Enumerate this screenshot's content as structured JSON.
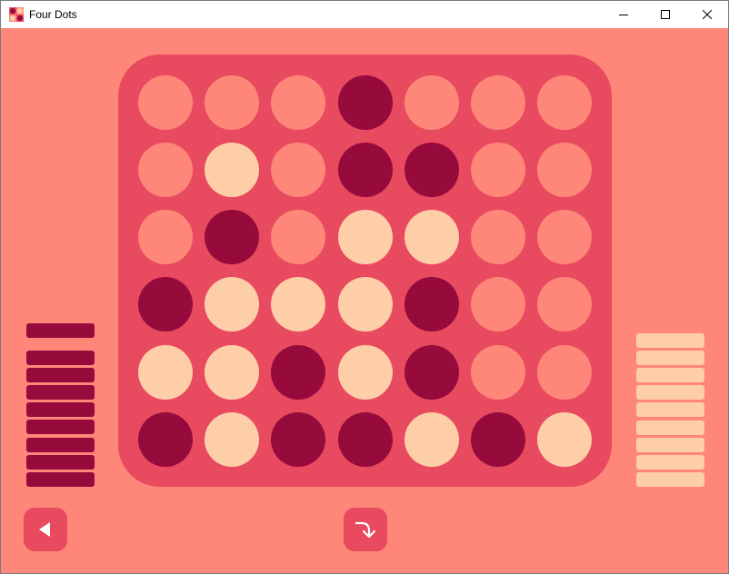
{
  "window": {
    "title": "Four Dots",
    "icons": {
      "app": "four-dots-app-icon",
      "minimize": "minimize-icon",
      "maximize": "maximize-icon",
      "close": "close-icon"
    }
  },
  "colors": {
    "background": "#ff8779",
    "board": "#e84a5f",
    "player_dark": "#960a3c",
    "player_light": "#fecea8",
    "empty": "#ff8779"
  },
  "board": {
    "rows": 6,
    "cols": 7,
    "cells": [
      [
        "empty",
        "empty",
        "empty",
        "dark",
        "empty",
        "empty",
        "empty"
      ],
      [
        "empty",
        "light",
        "empty",
        "dark",
        "dark",
        "empty",
        "empty"
      ],
      [
        "empty",
        "dark",
        "empty",
        "light",
        "light",
        "empty",
        "empty"
      ],
      [
        "dark",
        "light",
        "light",
        "light",
        "dark",
        "empty",
        "empty"
      ],
      [
        "light",
        "light",
        "dark",
        "light",
        "dark",
        "empty",
        "empty"
      ],
      [
        "dark",
        "light",
        "dark",
        "dark",
        "light",
        "dark",
        "light"
      ]
    ]
  },
  "left_stack": {
    "player": "dark",
    "top_marker": 1,
    "remaining": 8
  },
  "right_stack": {
    "player": "light",
    "remaining": 9
  },
  "controls": {
    "back_icon": "back-triangle-icon",
    "drop_icon": "drop-arrow-icon"
  }
}
